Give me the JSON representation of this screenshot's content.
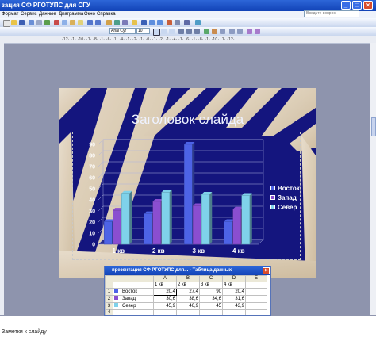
{
  "window": {
    "title": "зация СФ РГОТУПС для СГУ"
  },
  "menu": {
    "items": [
      "Формат",
      "Сервис",
      "Данные",
      "Диаграмма",
      "Окно",
      "Справка"
    ]
  },
  "help_search": {
    "placeholder": "Введите вопрос"
  },
  "toolbar": {
    "font_name": "Arial Cyr",
    "font_size": "10"
  },
  "ruler": {
    "text": "·12· ·1· ·10· ·1· ·8· ·1· ·6· ·1· ·4· ·1· ·2· ·1· ·0· ·1· ·2· ·1· ·4· ·1· ·6· ·1· ·8· ·1· ·10· ·1· ·12·"
  },
  "slide": {
    "title": "Заголовок слайда"
  },
  "chart_data": {
    "type": "bar",
    "categories": [
      "1 кв",
      "2 кв",
      "3 кв",
      "4 кв"
    ],
    "series": [
      {
        "name": "Восток",
        "values": [
          20.4,
          27.4,
          90,
          20.4
        ],
        "color": "#4d63e6"
      },
      {
        "name": "Запад",
        "values": [
          30.6,
          38.6,
          34.6,
          31.6
        ],
        "color": "#8a4ed0"
      },
      {
        "name": "Север",
        "values": [
          45.9,
          46.9,
          45,
          43.9
        ],
        "color": "#7fd2ea"
      }
    ],
    "y_ticks": [
      "0",
      "10",
      "20",
      "30",
      "40",
      "50",
      "60",
      "70",
      "80",
      "90"
    ],
    "ylim": [
      0,
      90
    ],
    "grid": true,
    "legend": "right"
  },
  "datasheet": {
    "title": "презентация СФ РГОТУПС для...  - Таблица данных",
    "col_letters": [
      "",
      "",
      "A",
      "B",
      "C",
      "D",
      "E"
    ],
    "quarters": [
      "1 кв",
      "2 кв",
      "3 кв",
      "4 кв"
    ],
    "rows": [
      {
        "num": "1",
        "name": "Восток",
        "vals": [
          "20,4",
          "27,4",
          "90",
          "20,4"
        ]
      },
      {
        "num": "2",
        "name": "Запад",
        "vals": [
          "30,6",
          "38,6",
          "34,6",
          "31,6"
        ]
      },
      {
        "num": "3",
        "name": "Север",
        "vals": [
          "45,9",
          "46,9",
          "45",
          "43,9"
        ]
      }
    ],
    "extra_row": "4"
  },
  "notes": {
    "placeholder": "Заметки к слайду"
  }
}
